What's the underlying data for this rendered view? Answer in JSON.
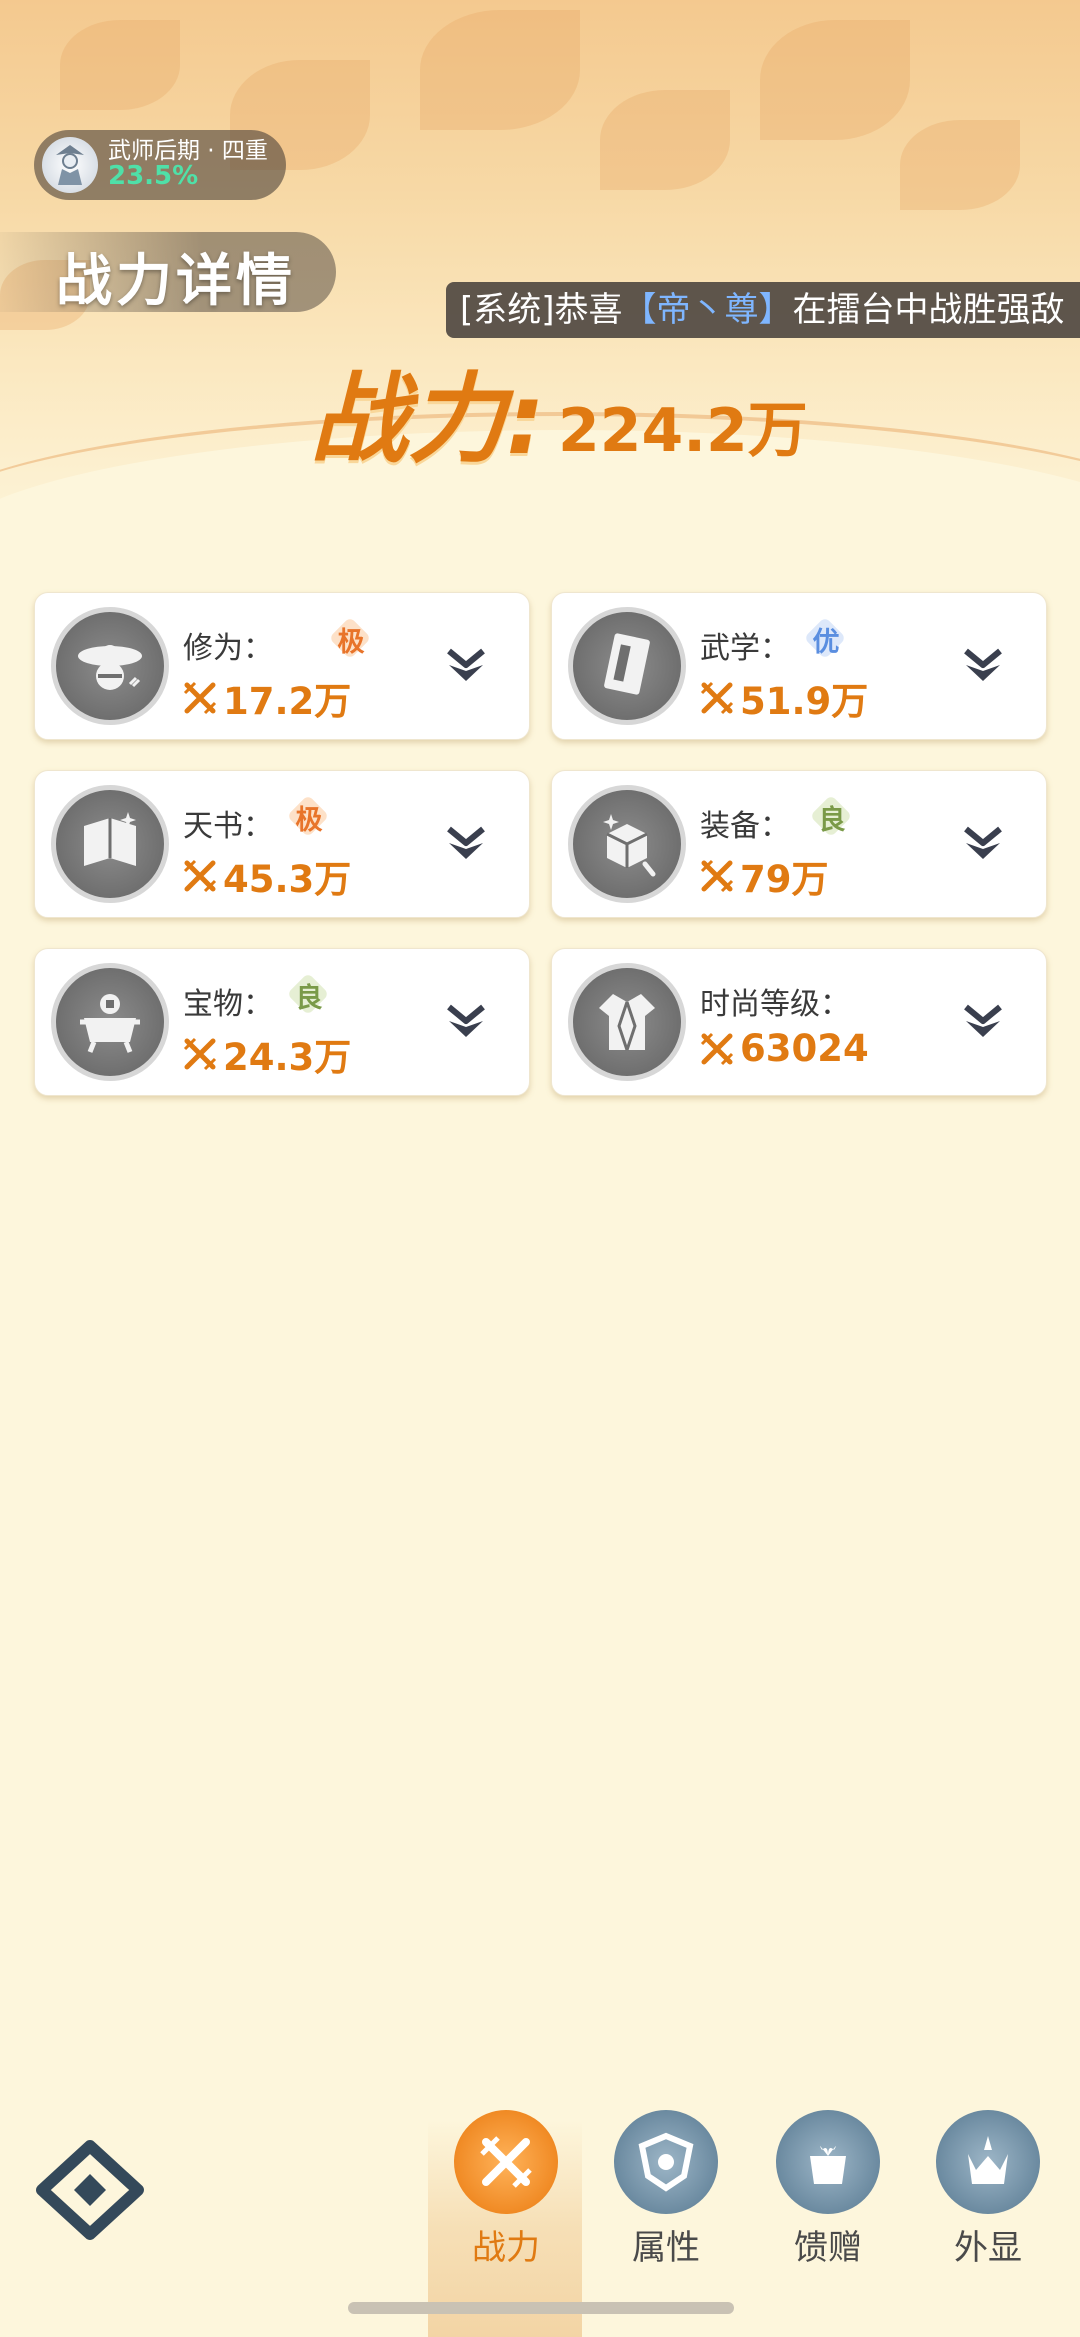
{
  "rank": {
    "name": "武师后期 · 四重",
    "progress": "23.5%"
  },
  "page_title": "战力详情",
  "ticker": {
    "prefix": "[系统]恭喜",
    "player": "【帝丶尊】",
    "suffix": "在擂台中战胜强敌"
  },
  "power": {
    "label": "战力:",
    "value": "224.2万"
  },
  "cards": [
    {
      "label": "修为：",
      "grade": "极",
      "value": "17.2万",
      "icon": "hermit-hat-icon"
    },
    {
      "label": "武学：",
      "grade": "优",
      "value": "51.9万",
      "icon": "martial-manual-icon"
    },
    {
      "label": "天书：",
      "grade": "极",
      "value": "45.3万",
      "icon": "heavenly-book-icon"
    },
    {
      "label": "装备：",
      "grade": "良",
      "value": "79万",
      "icon": "equipment-box-icon"
    },
    {
      "label": "宝物：",
      "grade": "良",
      "value": "24.3万",
      "icon": "treasure-cauldron-icon"
    },
    {
      "label": "时尚等级：",
      "grade": "",
      "value": "63024",
      "icon": "fashion-robe-icon"
    }
  ],
  "nav": [
    {
      "label": "战力",
      "icon": "crossed-swords-icon",
      "active": true
    },
    {
      "label": "属性",
      "icon": "attribute-shield-icon",
      "active": false
    },
    {
      "label": "馈赠",
      "icon": "gift-icon",
      "active": false
    },
    {
      "label": "外显",
      "icon": "appearance-crown-icon",
      "active": false
    }
  ],
  "colors": {
    "accent": "#e07a12",
    "grade_ji": "#e8742a",
    "grade_you": "#5a8ee0",
    "grade_liang": "#7a9a48",
    "rank_progress": "#4fe0a8",
    "ticker_highlight": "#7fb6ff"
  }
}
